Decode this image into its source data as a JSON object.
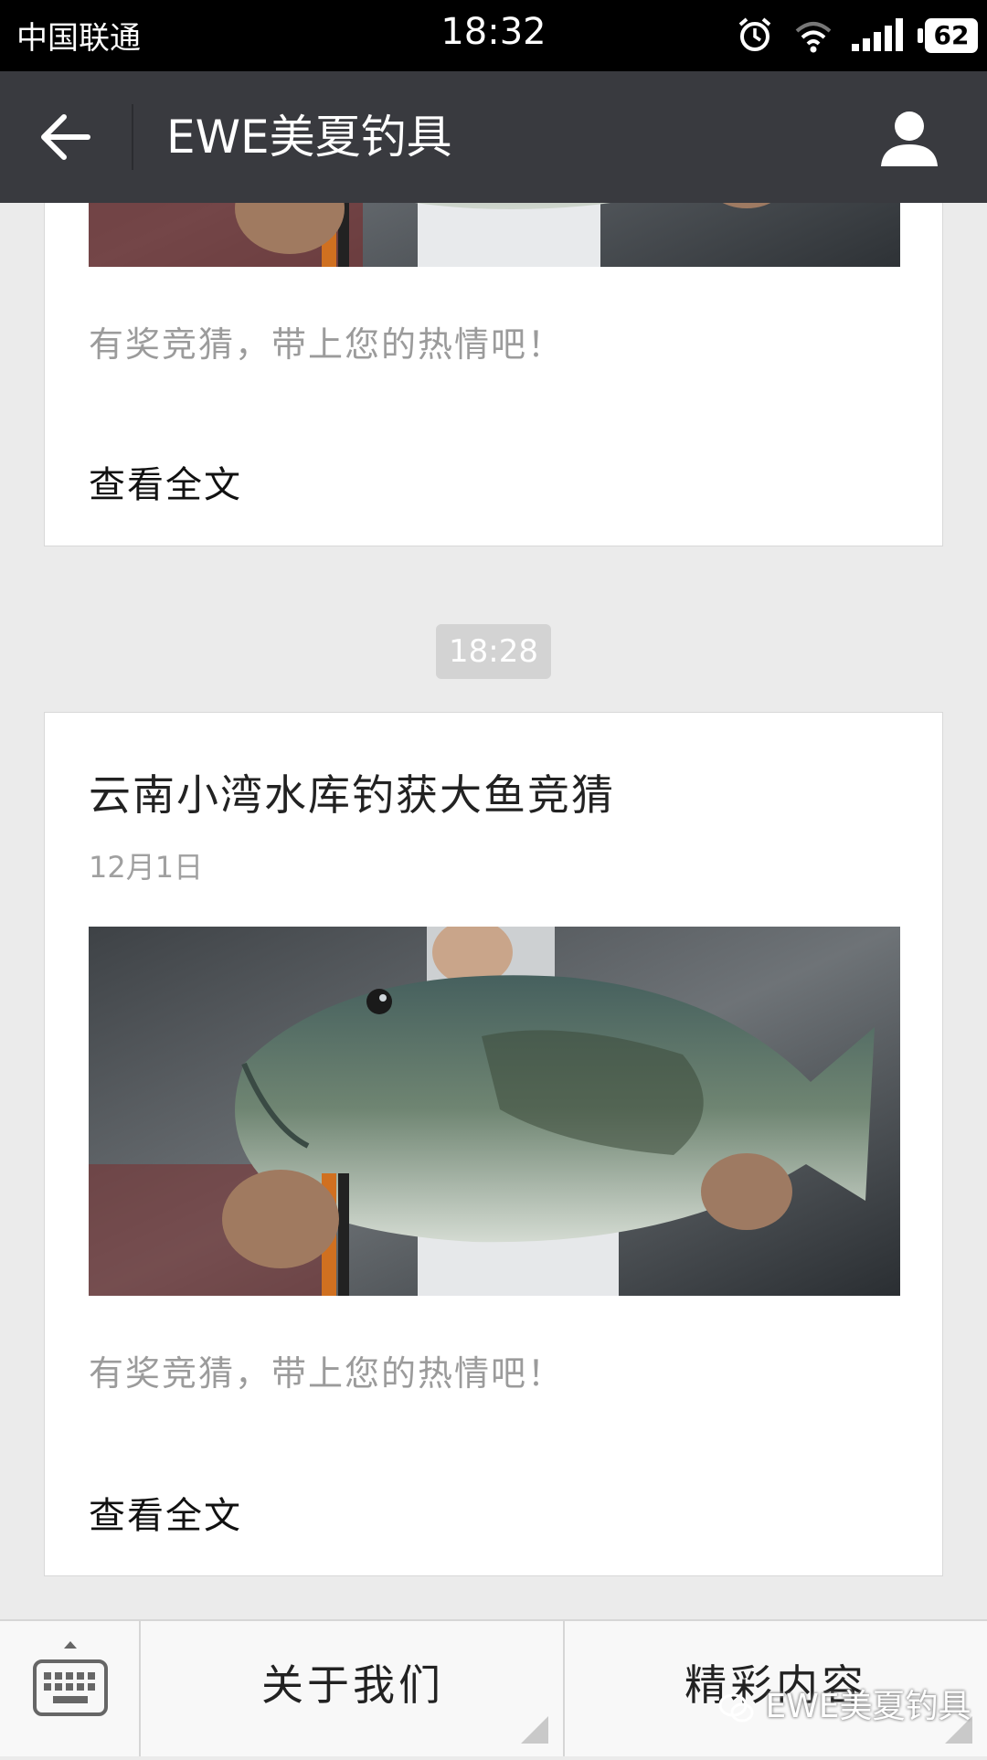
{
  "status_bar": {
    "carrier": "中国联通",
    "time": "18:32",
    "battery": "62",
    "icons": [
      "alarm-icon",
      "wifi-icon",
      "signal-icon",
      "battery-icon"
    ]
  },
  "header": {
    "title": "EWE美夏钓具",
    "back_icon": "back-arrow-icon",
    "profile_icon": "person-icon"
  },
  "feed": {
    "previous_card": {
      "digest": "有奖竞猜，带上您的热情吧！",
      "read_more": "查看全文"
    },
    "time_divider": "18:28",
    "article": {
      "title": "云南小湾水库钓获大鱼竞猜",
      "date": "12月1日",
      "digest": "有奖竞猜，带上您的热情吧！",
      "read_more": "查看全文"
    }
  },
  "bottom_menu": {
    "keyboard_icon": "keyboard-icon",
    "items": [
      {
        "label": "关于我们"
      },
      {
        "label": "精彩内容"
      }
    ]
  },
  "watermark": {
    "text": "EWE美夏钓具"
  },
  "colors": {
    "status_bar": "#000000",
    "title_bar": "#393a3f",
    "background": "#ebebeb",
    "card": "#ffffff",
    "time_badge": "#d3d3d3"
  }
}
